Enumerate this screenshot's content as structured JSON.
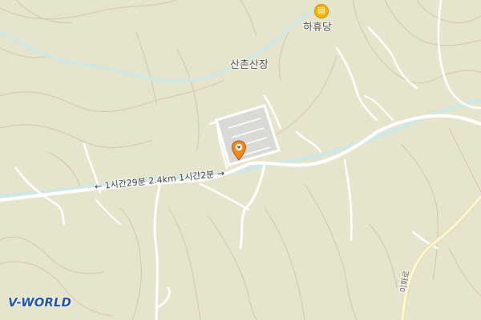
{
  "map": {
    "labels": {
      "village": "산촌산장",
      "rest_area": "하휴당",
      "route": "← 1시간29분  2.4km  1시간2분 →",
      "road": "이화로"
    },
    "rest_area_icon": {
      "name": "restaurant-icon",
      "glyph": "▤"
    },
    "marker": {
      "name": "location-pin-icon",
      "color": "#f08a1c"
    },
    "colors": {
      "terrain": "#e6e4cc",
      "contour": "#c9c4a4",
      "road": "#ffffff",
      "river": "#cbe6e3",
      "parking": "#d8d8d4"
    }
  },
  "branding": {
    "logo": "V-WORLD"
  }
}
